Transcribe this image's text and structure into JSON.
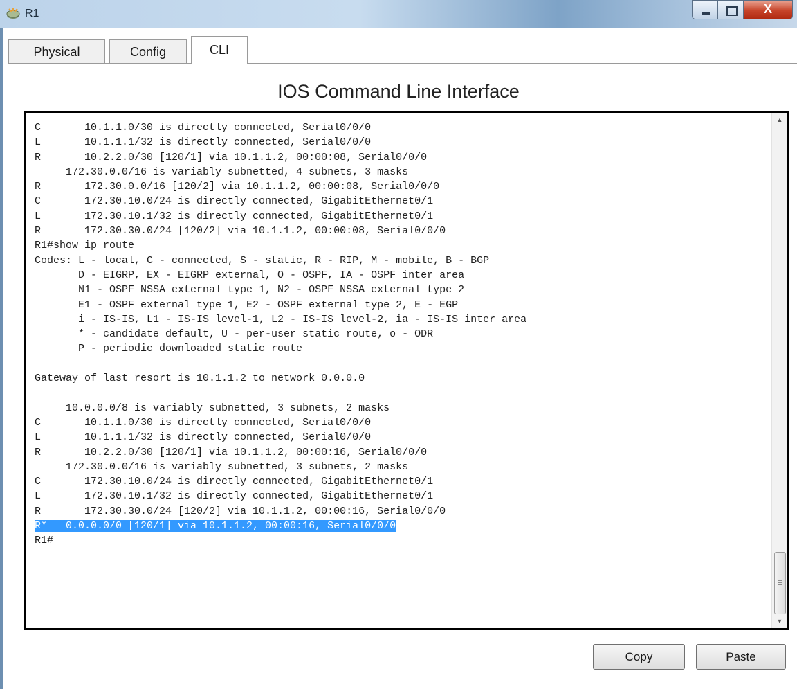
{
  "window": {
    "title": "R1"
  },
  "titlebar_buttons": {
    "close_label": "X"
  },
  "tabs": [
    {
      "label": "Physical"
    },
    {
      "label": "Config"
    },
    {
      "label": "CLI",
      "active": true
    }
  ],
  "heading": "IOS Command Line Interface",
  "terminal": {
    "lines": [
      "C       10.1.1.0/30 is directly connected, Serial0/0/0",
      "L       10.1.1.1/32 is directly connected, Serial0/0/0",
      "R       10.2.2.0/30 [120/1] via 10.1.1.2, 00:00:08, Serial0/0/0",
      "     172.30.0.0/16 is variably subnetted, 4 subnets, 3 masks",
      "R       172.30.0.0/16 [120/2] via 10.1.1.2, 00:00:08, Serial0/0/0",
      "C       172.30.10.0/24 is directly connected, GigabitEthernet0/1",
      "L       172.30.10.1/32 is directly connected, GigabitEthernet0/1",
      "R       172.30.30.0/24 [120/2] via 10.1.1.2, 00:00:08, Serial0/0/0",
      "R1#show ip route",
      "Codes: L - local, C - connected, S - static, R - RIP, M - mobile, B - BGP",
      "       D - EIGRP, EX - EIGRP external, O - OSPF, IA - OSPF inter area",
      "       N1 - OSPF NSSA external type 1, N2 - OSPF NSSA external type 2",
      "       E1 - OSPF external type 1, E2 - OSPF external type 2, E - EGP",
      "       i - IS-IS, L1 - IS-IS level-1, L2 - IS-IS level-2, ia - IS-IS inter area",
      "       * - candidate default, U - per-user static route, o - ODR",
      "       P - periodic downloaded static route",
      "",
      "Gateway of last resort is 10.1.1.2 to network 0.0.0.0",
      "",
      "     10.0.0.0/8 is variably subnetted, 3 subnets, 2 masks",
      "C       10.1.1.0/30 is directly connected, Serial0/0/0",
      "L       10.1.1.1/32 is directly connected, Serial0/0/0",
      "R       10.2.2.0/30 [120/1] via 10.1.1.2, 00:00:16, Serial0/0/0",
      "     172.30.0.0/16 is variably subnetted, 3 subnets, 2 masks",
      "C       172.30.10.0/24 is directly connected, GigabitEthernet0/1",
      "L       172.30.10.1/32 is directly connected, GigabitEthernet0/1",
      "R       172.30.30.0/24 [120/2] via 10.1.1.2, 00:00:16, Serial0/0/0",
      "R*   0.0.0.0/0 [120/1] via 10.1.1.2, 00:00:16, Serial0/0/0",
      "R1#"
    ],
    "highlighted_line_index": 27
  },
  "buttons": {
    "copy": "Copy",
    "paste": "Paste"
  },
  "colors": {
    "selection": "#3399ff",
    "close_button": "#c7442a"
  }
}
